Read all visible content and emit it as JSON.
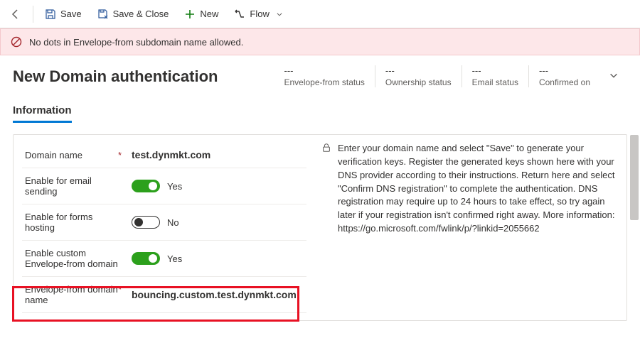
{
  "toolbar": {
    "save": "Save",
    "saveClose": "Save & Close",
    "new": "New",
    "flow": "Flow"
  },
  "alert": {
    "message": "No dots in Envelope-from subdomain name allowed."
  },
  "header": {
    "title": "New Domain authentication"
  },
  "status": {
    "envelope": {
      "value": "---",
      "label": "Envelope-from status"
    },
    "ownership": {
      "value": "---",
      "label": "Ownership status"
    },
    "email": {
      "value": "---",
      "label": "Email status"
    },
    "confirmed": {
      "value": "---",
      "label": "Confirmed on"
    }
  },
  "tabs": {
    "information": "Information"
  },
  "fields": {
    "domainName": {
      "label": "Domain name",
      "value": "test.dynmkt.com"
    },
    "enableEmail": {
      "label": "Enable for email sending",
      "value": "Yes"
    },
    "enableForms": {
      "label": "Enable for forms hosting",
      "value": "No"
    },
    "enableEnvelope": {
      "label": "Enable custom Envelope-from domain",
      "value": "Yes"
    },
    "envelopeName": {
      "label": "Envelope-from domain name",
      "value": "bouncing.custom.test.dynmkt.com"
    }
  },
  "info": {
    "text": "Enter your domain name and select \"Save\" to generate your verification keys. Register the generated keys shown here with your DNS provider according to their instructions. Return here and select \"Confirm DNS registration\" to complete the authentication. DNS registration may require up to 24 hours to take effect, so try again later if your registration isn't confirmed right away. More information: https://go.microsoft.com/fwlink/p/?linkid=2055662"
  }
}
